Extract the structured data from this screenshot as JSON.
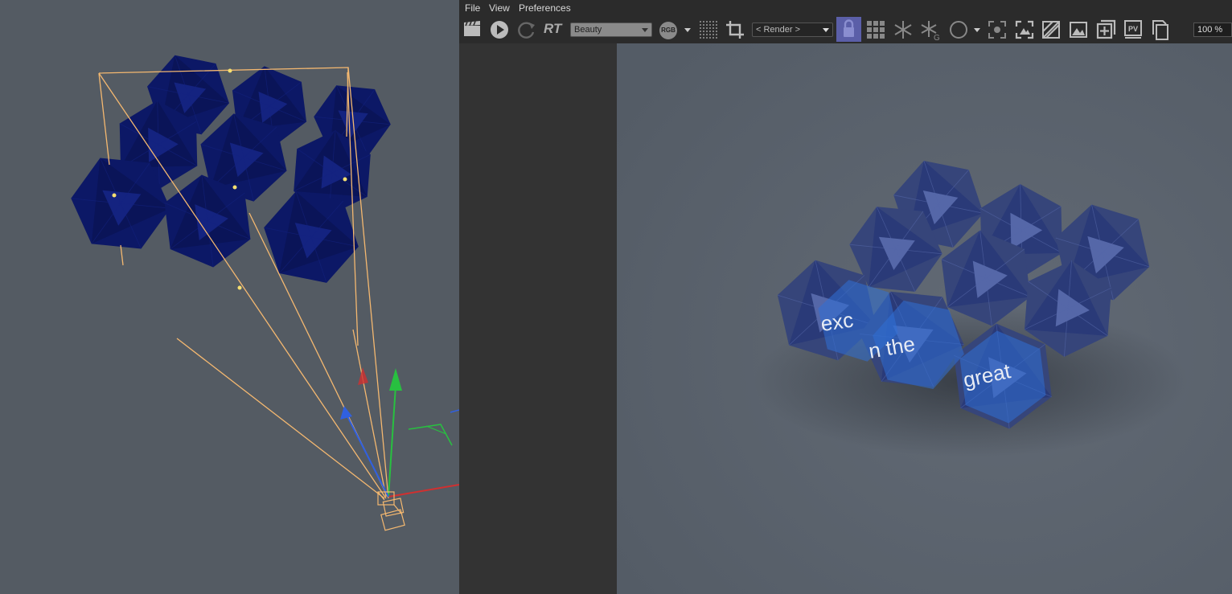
{
  "menu": {
    "file": "File",
    "view": "View",
    "preferences": "Preferences"
  },
  "toolbar": {
    "rt_label": "RT",
    "pass_select": "Beauty",
    "rgb_label": "RGB",
    "render_select": "< Render >",
    "pv_label": "PV",
    "zoom": "100 %"
  },
  "render": {
    "text_words": [
      "exc",
      "n the",
      "great"
    ]
  },
  "colors": {
    "viewport_bg": "#545b63",
    "render_bg": "#5a626c",
    "toolbar_bg": "#2b2b2b",
    "active_tool": "#5b5fa8",
    "frustum": "#f4b870",
    "axis_x": "#d03030",
    "axis_y": "#28c040",
    "axis_z": "#3060e0"
  },
  "icons": {
    "clapper": "clapper-icon",
    "play": "play-icon",
    "refresh": "refresh-icon",
    "region": "region-grid-icon",
    "crop": "crop-icon",
    "lock": "lock-icon",
    "grid": "grid-icon",
    "snow": "snowflake-icon",
    "snow_g": "snowflake-g-icon",
    "circle": "circle-icon"
  }
}
